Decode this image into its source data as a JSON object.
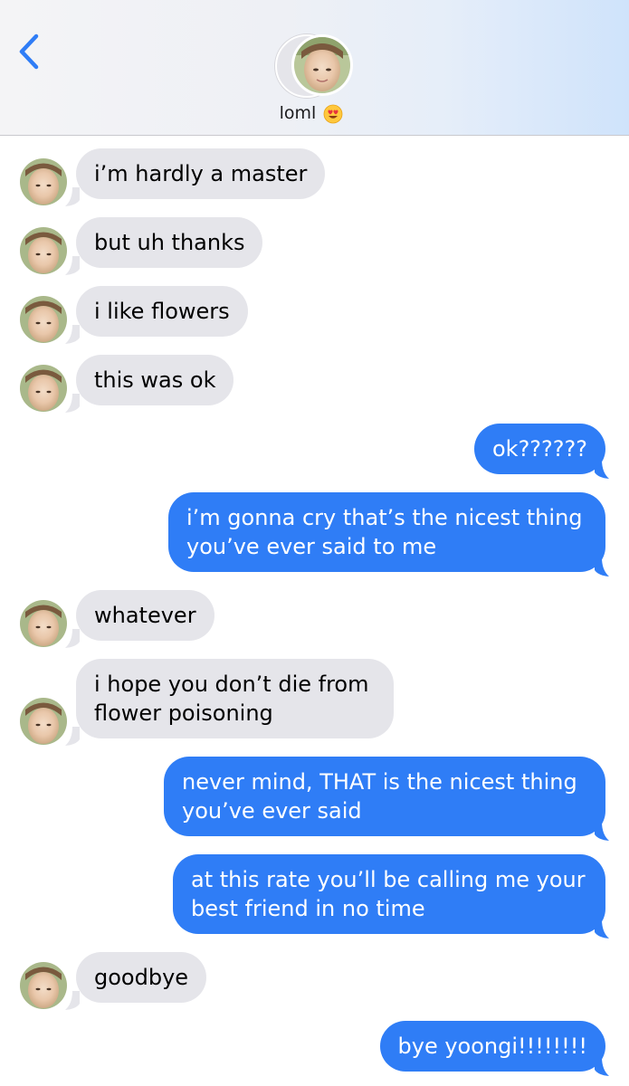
{
  "header": {
    "contact_name": "loml",
    "back_icon": "chevron-left-icon",
    "contact_emoji": "heart-eyes-emoji",
    "accent_color": "#2f7df6"
  },
  "messages": [
    {
      "direction": "incoming",
      "lines": [
        "i’m hardly a master"
      ]
    },
    {
      "direction": "incoming",
      "lines": [
        "but uh thanks"
      ]
    },
    {
      "direction": "incoming",
      "lines": [
        "i like flowers"
      ]
    },
    {
      "direction": "incoming",
      "lines": [
        "this was ok"
      ]
    },
    {
      "direction": "outgoing",
      "lines": [
        "ok??????"
      ]
    },
    {
      "direction": "outgoing",
      "lines": [
        "i’m gonna cry that’s the nicest thing",
        "you’ve ever said to me"
      ]
    },
    {
      "direction": "incoming",
      "lines": [
        "whatever"
      ]
    },
    {
      "direction": "incoming",
      "lines": [
        "i hope you don’t die from",
        "flower poisoning"
      ]
    },
    {
      "direction": "outgoing",
      "lines": [
        "never mind, THAT is the nicest thing",
        "you’ve ever said"
      ]
    },
    {
      "direction": "outgoing",
      "lines": [
        "at this rate you’ll be calling me your",
        "best friend in no time"
      ]
    },
    {
      "direction": "incoming",
      "lines": [
        "goodbye"
      ]
    },
    {
      "direction": "outgoing",
      "lines": [
        "bye yoongi!!!!!!!!"
      ]
    }
  ],
  "colors": {
    "incoming_bubble": "#e5e5ea",
    "outgoing_bubble": "#2f7df6"
  }
}
